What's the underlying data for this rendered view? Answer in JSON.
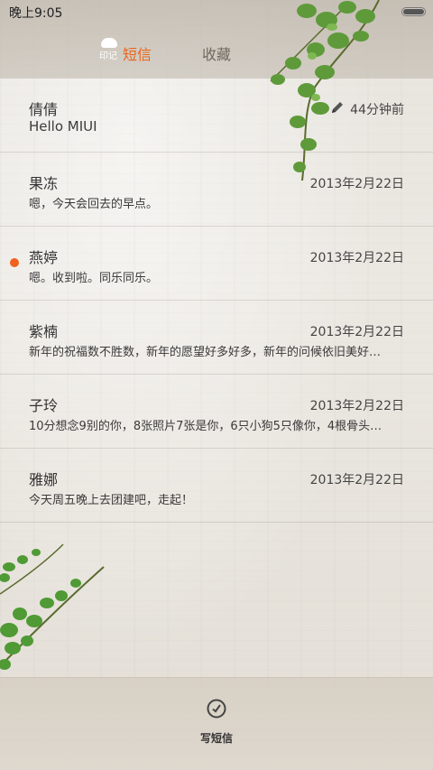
{
  "status_bar": {
    "time": "晚上9:05"
  },
  "header": {
    "logo_text": "印记",
    "tabs": [
      {
        "label": "短信",
        "active": true
      },
      {
        "label": "收藏",
        "active": false
      }
    ]
  },
  "conversations": [
    {
      "name": "倩倩",
      "preview": "Hello MIUI",
      "time": "44分钟前",
      "draft": true,
      "unread": false
    },
    {
      "name": "果冻",
      "preview": "嗯，今天会回去的早点。",
      "time": "2013年2月22日",
      "draft": false,
      "unread": false
    },
    {
      "name": "燕婷",
      "preview": "嗯。收到啦。同乐同乐。",
      "time": "2013年2月22日",
      "draft": false,
      "unread": true
    },
    {
      "name": "紫楠",
      "preview": "新年的祝福数不胜数，新年的愿望好多好多，新年的问候依旧美好…",
      "time": "2013年2月22日",
      "draft": false,
      "unread": false
    },
    {
      "name": "子玲",
      "preview": "10分想念9别的你，8张照片7张是你，6只小狗5只像你，4根骨头…",
      "time": "2013年2月22日",
      "draft": false,
      "unread": false
    },
    {
      "name": "雅娜",
      "preview": "今天周五晚上去团建吧，走起！",
      "time": "2013年2月22日",
      "draft": false,
      "unread": false
    }
  ],
  "bottom": {
    "compose_label": "写短信"
  },
  "colors": {
    "accent": "#e8661c",
    "unread_dot": "#f0601e"
  }
}
